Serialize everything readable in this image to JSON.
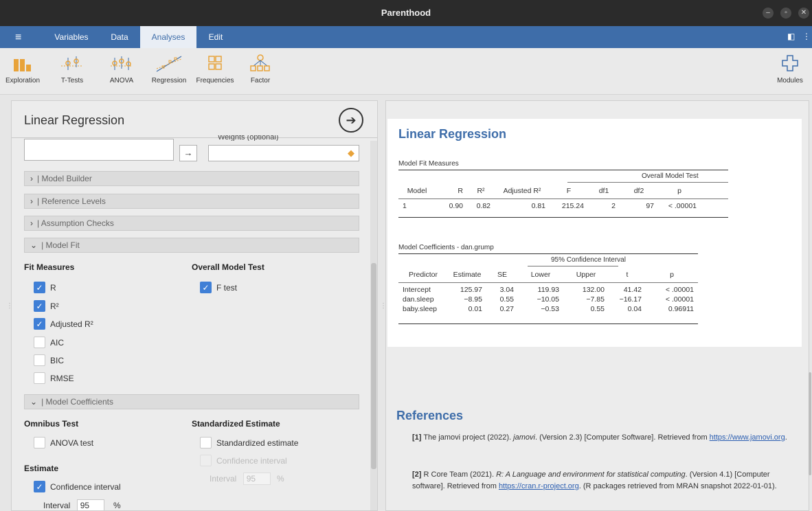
{
  "window": {
    "title": "Parenthood"
  },
  "menubar": {
    "tabs": [
      {
        "label": "Variables"
      },
      {
        "label": "Data"
      },
      {
        "label": "Analyses"
      },
      {
        "label": "Edit"
      }
    ]
  },
  "toolbar": {
    "tools": [
      {
        "label": "Exploration"
      },
      {
        "label": "T-Tests"
      },
      {
        "label": "ANOVA"
      },
      {
        "label": "Regression"
      },
      {
        "label": "Frequencies"
      },
      {
        "label": "Factor"
      }
    ],
    "modules": "Modules"
  },
  "options": {
    "title": "Linear Regression",
    "weights_label": "Weights (optional)",
    "sections": {
      "model_builder": "Model Builder",
      "reference_levels": "Reference Levels",
      "assumption_checks": "Assumption Checks",
      "model_fit": "Model Fit",
      "model_coefficients": "Model Coefficients"
    },
    "fit_measures": {
      "header": "Fit Measures",
      "items": [
        {
          "label": "R",
          "checked": true
        },
        {
          "label": "R²",
          "checked": true
        },
        {
          "label": "Adjusted R²",
          "checked": true
        },
        {
          "label": "AIC",
          "checked": false
        },
        {
          "label": "BIC",
          "checked": false
        },
        {
          "label": "RMSE",
          "checked": false
        }
      ]
    },
    "overall_model_test": {
      "header": "Overall Model Test",
      "ftest": {
        "label": "F test",
        "checked": true
      }
    },
    "omnibus": {
      "header": "Omnibus Test",
      "anova": {
        "label": "ANOVA test",
        "checked": false
      }
    },
    "standardized": {
      "header": "Standardized Estimate",
      "std_est": {
        "label": "Standardized estimate",
        "checked": false
      },
      "ci": {
        "label": "Confidence interval",
        "checked": false
      },
      "interval_label": "Interval",
      "interval_value": "95",
      "pct": "%"
    },
    "estimate": {
      "header": "Estimate",
      "ci": {
        "label": "Confidence interval",
        "checked": true
      },
      "interval_label": "Interval",
      "interval_value": "95",
      "pct": "%"
    }
  },
  "results": {
    "title": "Linear Regression",
    "fit_table": {
      "caption": "Model Fit Measures",
      "group_header": "Overall Model Test",
      "headers": [
        "Model",
        "R",
        "R²",
        "Adjusted R²",
        "F",
        "df1",
        "df2",
        "p"
      ],
      "row": [
        "1",
        "0.90",
        "0.82",
        "0.81",
        "215.24",
        "2",
        "97",
        "< .00001"
      ]
    },
    "coef_table": {
      "caption": "Model Coefficients - dan.grump",
      "group_header": "95% Confidence Interval",
      "headers": [
        "Predictor",
        "Estimate",
        "SE",
        "Lower",
        "Upper",
        "t",
        "p"
      ],
      "rows": [
        [
          "Intercept",
          "125.97",
          "3.04",
          "119.93",
          "132.00",
          "41.42",
          "< .00001"
        ],
        [
          "dan.sleep",
          "−8.95",
          "0.55",
          "−10.05",
          "−7.85",
          "−16.17",
          "< .00001"
        ],
        [
          "baby.sleep",
          "0.01",
          "0.27",
          "−0.53",
          "0.55",
          "0.04",
          "0.96911"
        ]
      ]
    },
    "references": {
      "title": "References",
      "r1": {
        "num": "[1]",
        "pre": "The jamovi project (2022).",
        "ital": "jamovi",
        "post": ". (Version 2.3) [Computer Software]. Retrieved from",
        "link": "https://www.jamovi.org",
        "end": "."
      },
      "r2": {
        "num": "[2]",
        "pre": "R Core Team (2021).",
        "ital": "R: A Language and environment for statistical computing",
        "post": ". (Version 4.1) [Computer software]. Retrieved from",
        "link": "https://cran.r-project.org",
        "end": ". (R packages retrieved from MRAN snapshot 2022-01-01)."
      }
    }
  }
}
